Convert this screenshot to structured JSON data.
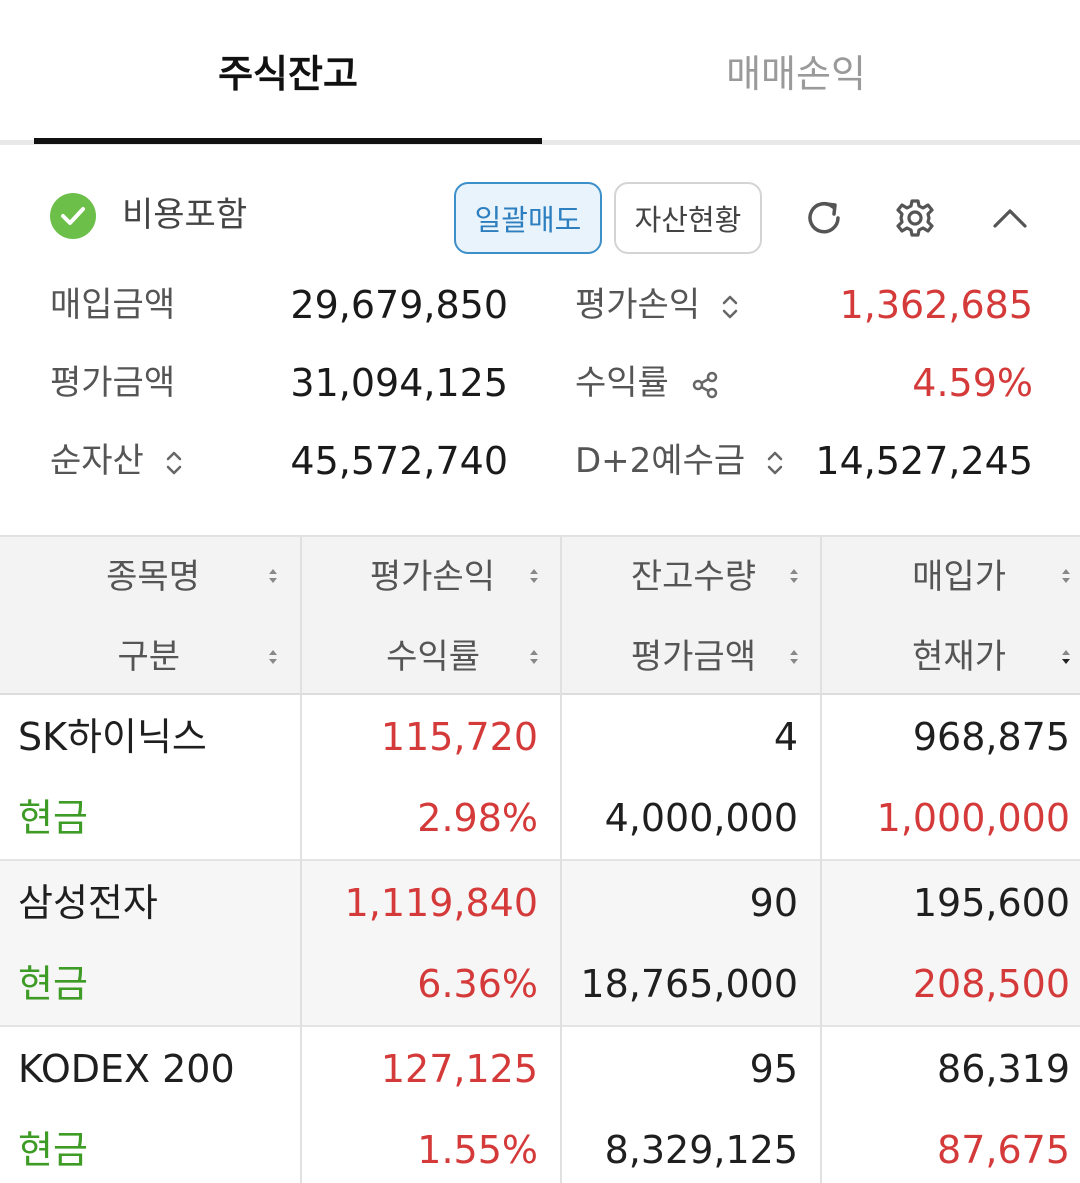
{
  "tabs": [
    {
      "label": "주식잔고",
      "active": true
    },
    {
      "label": "매매손익",
      "active": false
    }
  ],
  "toolbar": {
    "cost_label": "비용포함",
    "sell_all_label": "일괄매도",
    "asset_label": "자산현황",
    "icons": [
      "check-icon",
      "refresh-icon",
      "gear-icon",
      "chevron-up-icon"
    ]
  },
  "summary": {
    "purchase_amount_label": "매입금액",
    "purchase_amount": "29,679,850",
    "eval_amount_label": "평가금액",
    "eval_amount": "31,094,125",
    "net_asset_label": "순자산",
    "net_asset": "45,572,740",
    "eval_pl_label": "평가손익",
    "eval_pl": "1,362,685",
    "return_label": "수익률",
    "return_rate": "4.59%",
    "deposit_label": "D+2예수금",
    "deposit": "14,527,245"
  },
  "table": {
    "headers": {
      "col1_top": "종목명",
      "col1_bottom": "구분",
      "col2_top": "평가손익",
      "col2_bottom": "수익률",
      "col3_top": "잔고수량",
      "col3_bottom": "평가금액",
      "col4_top": "매입가",
      "col4_bottom": "현재가"
    },
    "rows": [
      {
        "name": "SK하이닉스",
        "type": "현금",
        "eval_pl": "115,720",
        "return_rate": "2.98%",
        "quantity": "4",
        "eval_amount": "4,000,000",
        "buy_price": "968,875",
        "current_price": "1,000,000"
      },
      {
        "name": "삼성전자",
        "type": "현금",
        "eval_pl": "1,119,840",
        "return_rate": "6.36%",
        "quantity": "90",
        "eval_amount": "18,765,000",
        "buy_price": "195,600",
        "current_price": "208,500"
      },
      {
        "name": "KODEX 200",
        "type": "현금",
        "eval_pl": "127,125",
        "return_rate": "1.55%",
        "quantity": "95",
        "eval_amount": "8,329,125",
        "buy_price": "86,319",
        "current_price": "87,675"
      }
    ]
  },
  "colors": {
    "profit_red": "#d53a3a",
    "cash_green": "#3e9b26",
    "check_green": "#6cc04a",
    "accent_blue": "#2d7fc0"
  }
}
